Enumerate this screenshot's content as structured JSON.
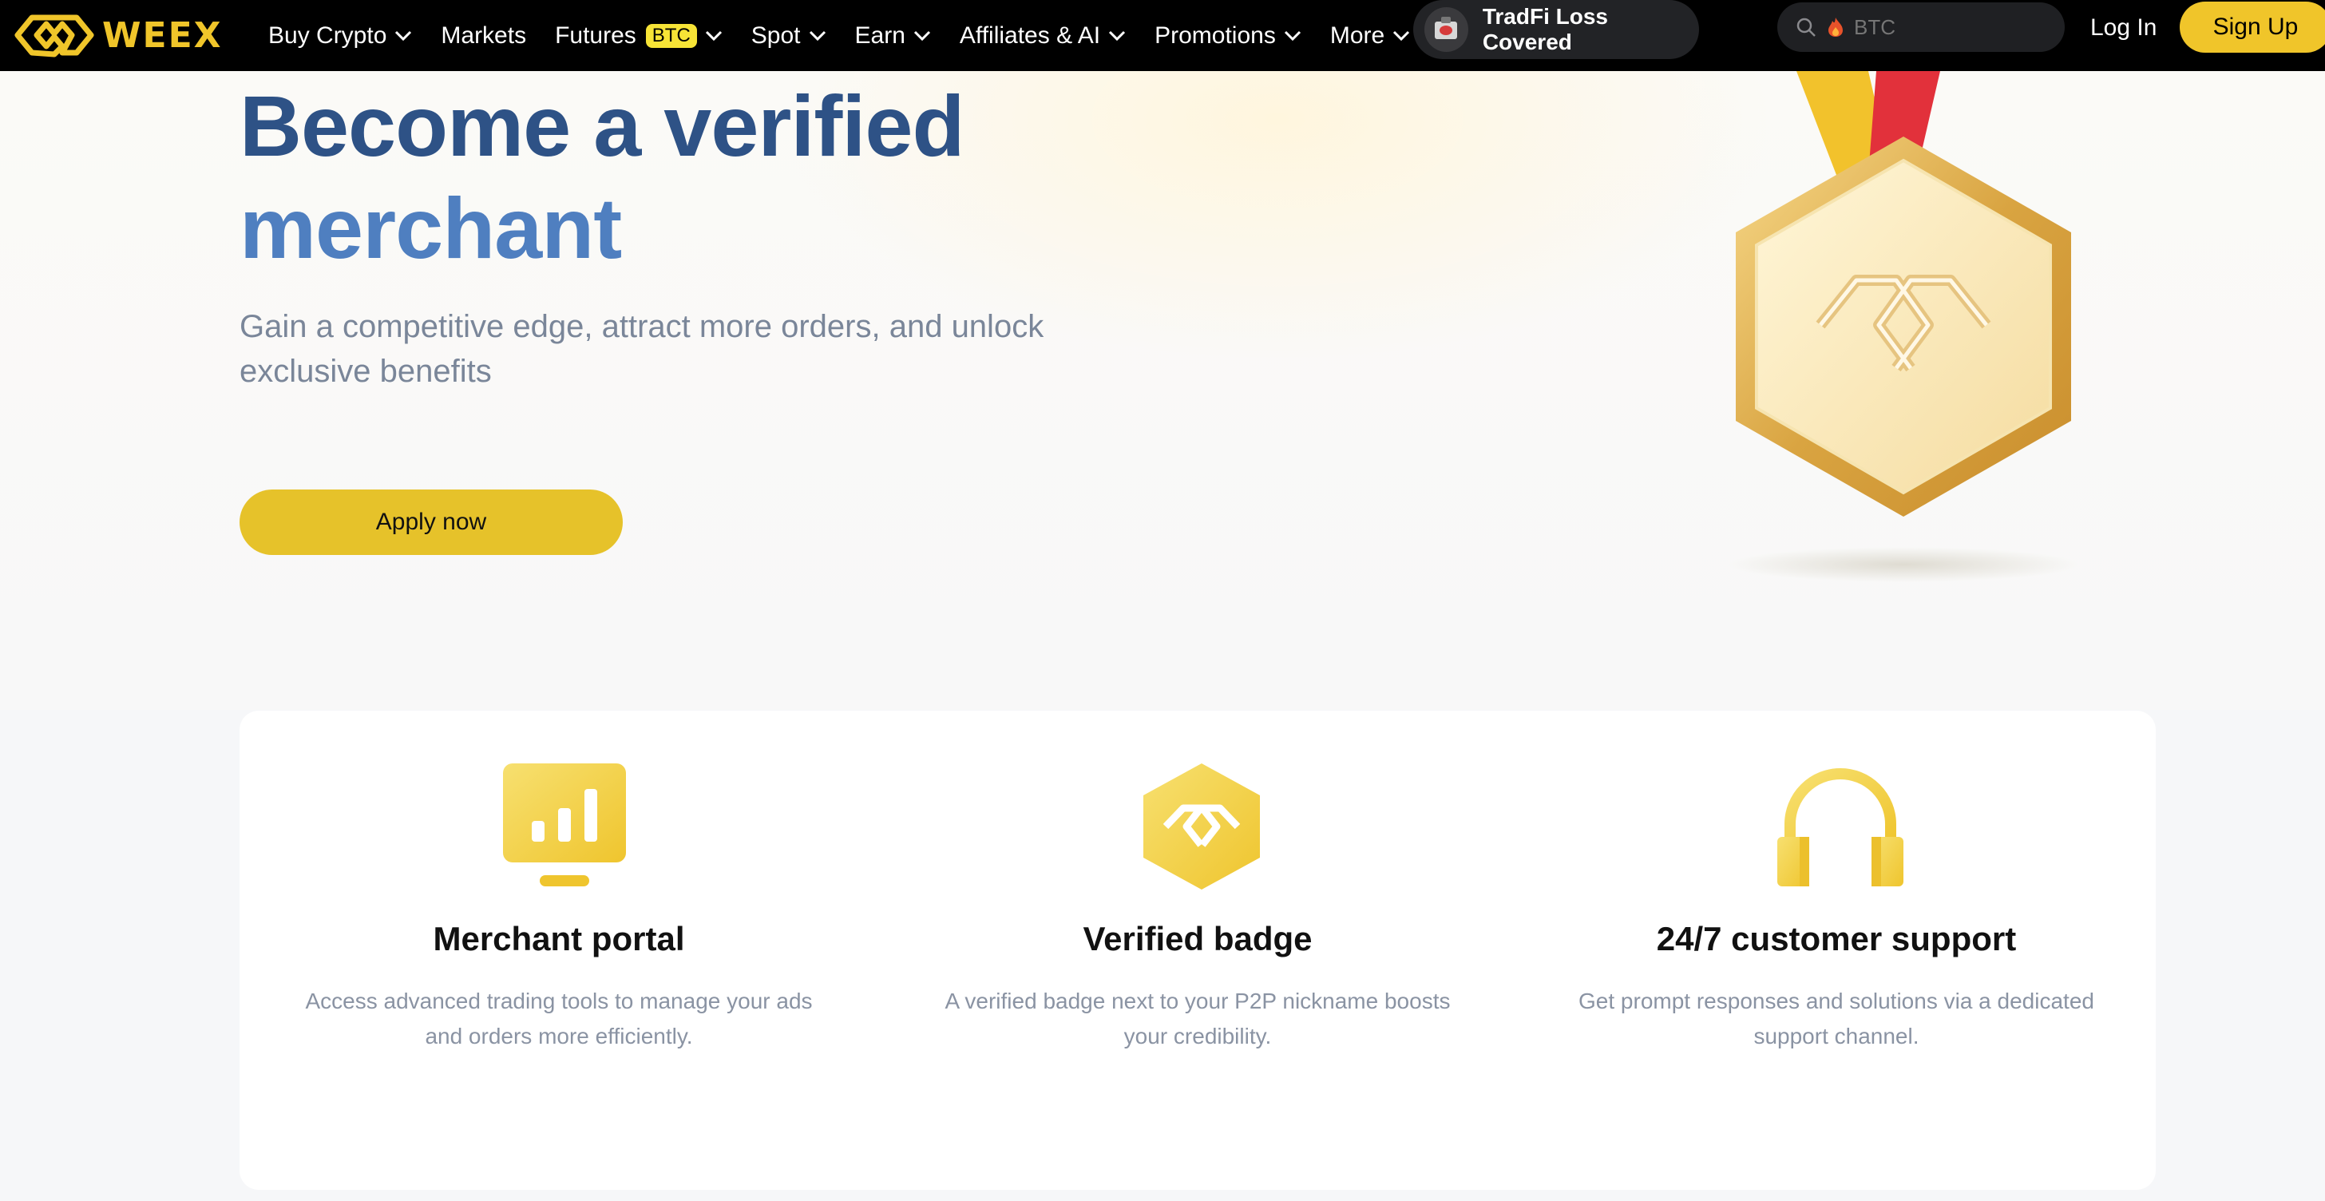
{
  "nav": {
    "logo_text": "WEEX",
    "menu": [
      {
        "label": "Buy Crypto",
        "has_dropdown": true
      },
      {
        "label": "Markets",
        "has_dropdown": false
      },
      {
        "label": "Futures",
        "badge": "BTC",
        "has_dropdown": true
      },
      {
        "label": "Spot",
        "has_dropdown": true
      },
      {
        "label": "Earn",
        "has_dropdown": true
      },
      {
        "label": "Affiliates & AI",
        "has_dropdown": true
      },
      {
        "label": "Promotions",
        "has_dropdown": true
      },
      {
        "label": "More",
        "has_dropdown": true
      }
    ],
    "promo_label": "TradFi Loss Covered",
    "search_placeholder": "BTC",
    "login_label": "Log In",
    "signup_label": "Sign Up"
  },
  "hero": {
    "title_line1": "Become a verified",
    "title_line2": "merchant",
    "subtitle": "Gain a competitive edge, attract more orders, and unlock exclusive benefits",
    "apply_label": "Apply now"
  },
  "features": [
    {
      "icon": "monitor-chart-icon",
      "title": "Merchant portal",
      "desc": "Access advanced trading tools to manage your ads and orders more efficiently."
    },
    {
      "icon": "hexagon-badge-icon",
      "title": "Verified badge",
      "desc": "A verified badge next to your P2P nickname boosts your credibility."
    },
    {
      "icon": "headphones-icon",
      "title": "24/7 customer support",
      "desc": "Get prompt responses and solutions via a dedicated support channel."
    }
  ],
  "colors": {
    "brand_yellow": "#f0c52a",
    "title_dark_blue": "#2e5286",
    "title_light_blue": "#4f7fc0",
    "nav_bg": "#000000"
  }
}
